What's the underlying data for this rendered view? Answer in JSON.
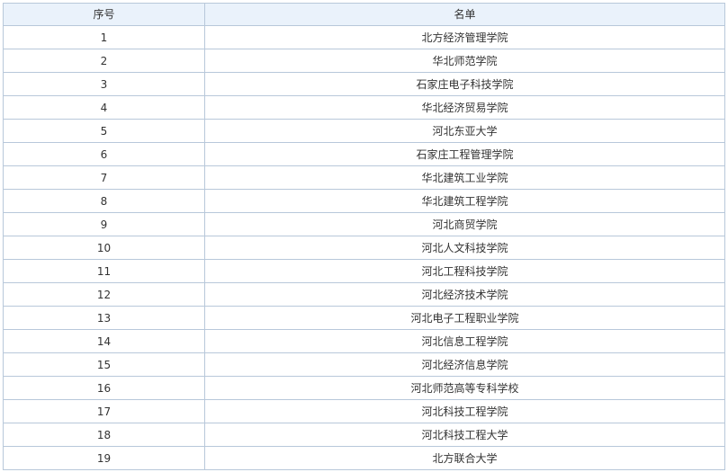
{
  "table": {
    "headers": {
      "index": "序号",
      "name": "名单"
    },
    "rows": [
      {
        "index": "1",
        "name": "北方经济管理学院"
      },
      {
        "index": "2",
        "name": "华北师范学院"
      },
      {
        "index": "3",
        "name": "石家庄电子科技学院"
      },
      {
        "index": "4",
        "name": "华北经济贸易学院"
      },
      {
        "index": "5",
        "name": "河北东亚大学"
      },
      {
        "index": "6",
        "name": "石家庄工程管理学院"
      },
      {
        "index": "7",
        "name": "华北建筑工业学院"
      },
      {
        "index": "8",
        "name": "华北建筑工程学院"
      },
      {
        "index": "9",
        "name": "河北商贸学院"
      },
      {
        "index": "10",
        "name": "河北人文科技学院"
      },
      {
        "index": "11",
        "name": "河北工程科技学院"
      },
      {
        "index": "12",
        "name": "河北经济技术学院"
      },
      {
        "index": "13",
        "name": "河北电子工程职业学院"
      },
      {
        "index": "14",
        "name": "河北信息工程学院"
      },
      {
        "index": "15",
        "name": "河北经济信息学院"
      },
      {
        "index": "16",
        "name": "河北师范高等专科学校"
      },
      {
        "index": "17",
        "name": "河北科技工程学院"
      },
      {
        "index": "18",
        "name": "河北科技工程大学"
      },
      {
        "index": "19",
        "name": "北方联合大学"
      }
    ]
  }
}
